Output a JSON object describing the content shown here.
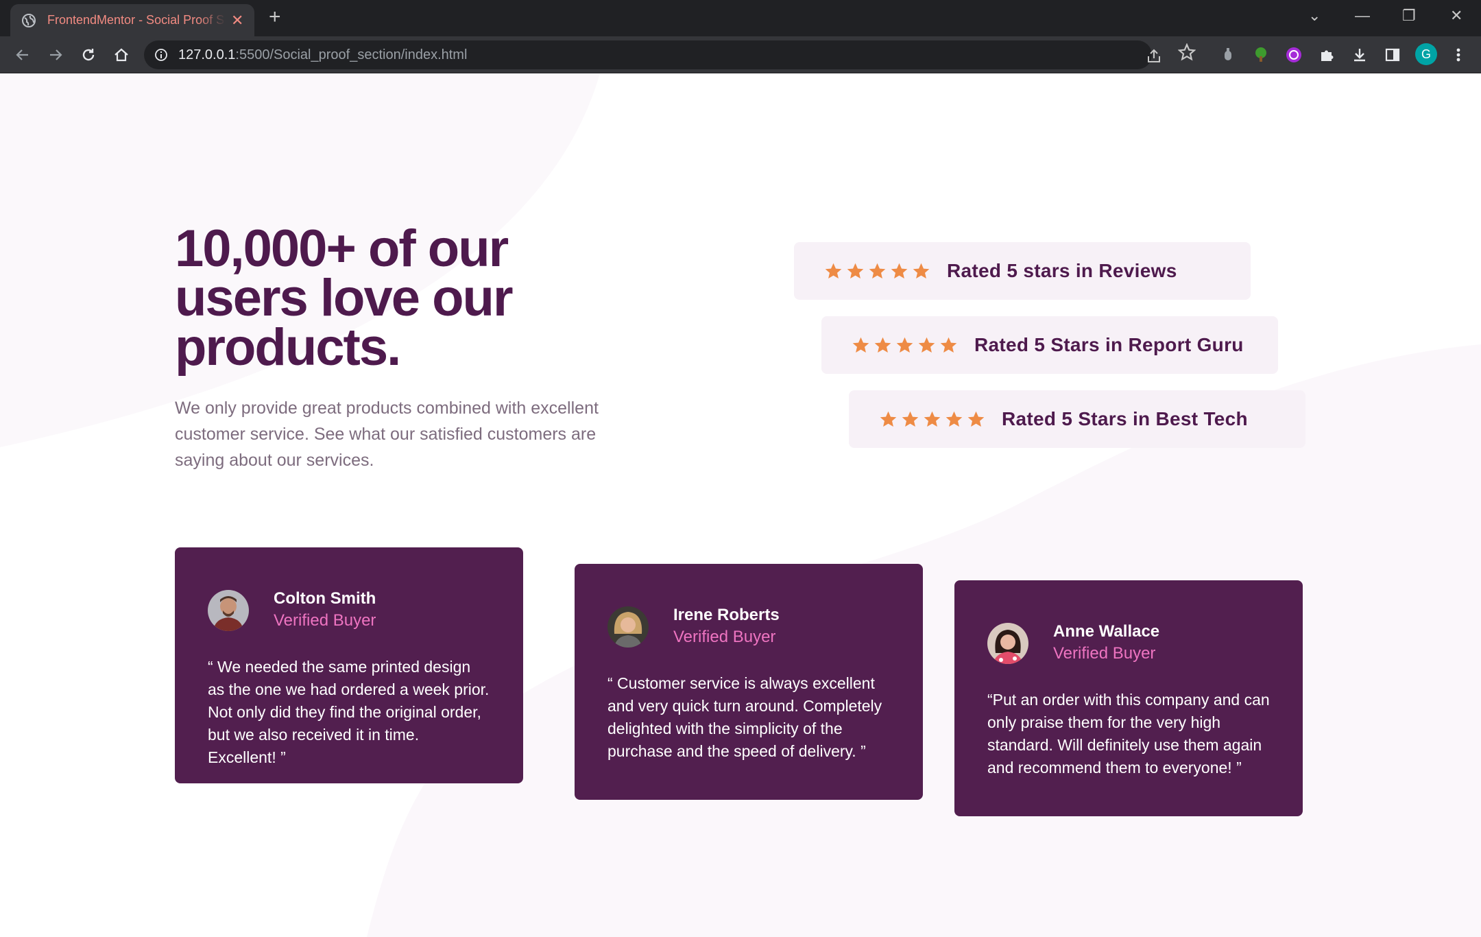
{
  "browser": {
    "tab_title": "FrontendMentor - Social Proof Section",
    "tab_close": "✕",
    "new_tab": "+",
    "url_host": "127.0.0.1",
    "url_rest": ":5500/Social_proof_section/index.html",
    "profile_initial": "G",
    "window_controls": {
      "tablist": "⌄",
      "minimize": "—",
      "restore": "❐",
      "close": "✕"
    }
  },
  "hero": {
    "headline": "10,000+ of our users love our products.",
    "intro": "We only provide great products combined with excellent customer service. See what our satisfied customers are saying about our services."
  },
  "ratings": [
    {
      "label": "Rated 5 stars in Reviews",
      "stars": 5
    },
    {
      "label": "Rated 5 Stars in Report Guru",
      "stars": 5
    },
    {
      "label": "Rated 5 Stars in Best Tech",
      "stars": 5
    }
  ],
  "testimonials": [
    {
      "name": "Colton Smith",
      "role": "Verified Buyer",
      "quote": "“ We needed the same printed design as the one we had ordered a week prior. Not only did they find the original order, but we also received it in time. Excellent! ”"
    },
    {
      "name": "Irene Roberts",
      "role": "Verified Buyer",
      "quote": "“ Customer service is always excellent and very quick turn around. Completely delighted with the simplicity of the purchase and the speed of delivery. ”"
    },
    {
      "name": "Anne Wallace",
      "role": "Verified Buyer",
      "quote": "“Put an order with this company and can only praise them for the very high standard. Will definitely use them again and recommend them to everyone! ”"
    }
  ],
  "colors": {
    "dark_magenta": "#4e1a4d",
    "card_bg": "#521f4f",
    "rating_bg": "#f7f1f7",
    "star": "#ee8b45",
    "verified_pink": "#ee74c1",
    "grayish_text": "#7d6c7e"
  }
}
